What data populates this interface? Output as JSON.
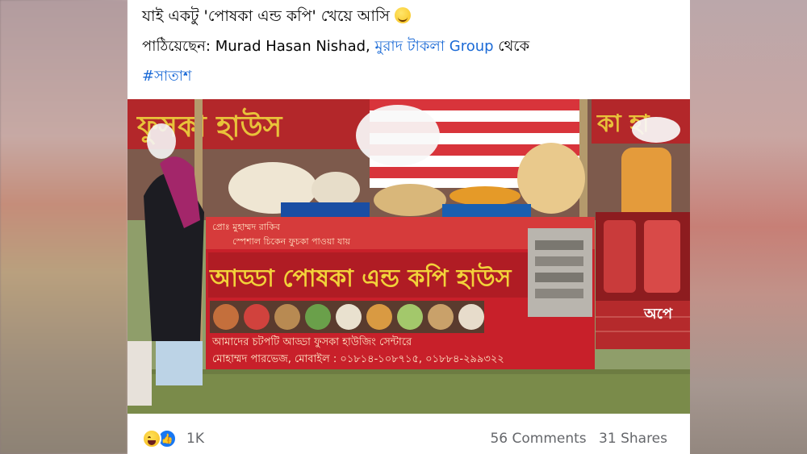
{
  "post": {
    "line1": "যাই একটু 'পোষকা এন্ড কপি' খেয়ে আসি",
    "line1_emoji": "smiling-face-emoji",
    "sent_by_prefix": "পাঠিয়েছেন: ",
    "author": "Murad Hasan Nishad",
    "separator": ", ",
    "group": "মুরাদ টাকলা Group",
    "sent_by_suffix": " থেকে",
    "hashtag": "#সাতাশ"
  },
  "photo": {
    "top_sign_left": "ফুসকা হাউস",
    "top_sign_right": "কা হা",
    "banner_small_1": "প্রোঃ মুহাম্মদ রাকিব",
    "banner_small_2": "স্পেশাল চিকেন ফুচকা পাওয়া যায়",
    "banner_title": "আড্ডা পোষকা এন্ড কপি হাউস",
    "banner_bottom_1": "আমাদের চটপটি আড্ডা ফুসকা হাউজিং সেন্টারে",
    "banner_bottom_2": "মোহাম্মদ পারভেজ, মোবাইল : ০১৮১৪-১০৮৭১৫, ০১৮৮৪-২৯৯৩২২",
    "right_banner_text": "অপে"
  },
  "footer": {
    "reaction_icons": [
      "haha-icon",
      "like-icon"
    ],
    "reaction_count": "1K",
    "comments": "56 Comments",
    "shares": "31 Shares"
  },
  "colors": {
    "link": "#1b6ad6",
    "banner_red": "#c8202a",
    "banner_yellow": "#f2d23a",
    "like_blue": "#1877f2"
  }
}
